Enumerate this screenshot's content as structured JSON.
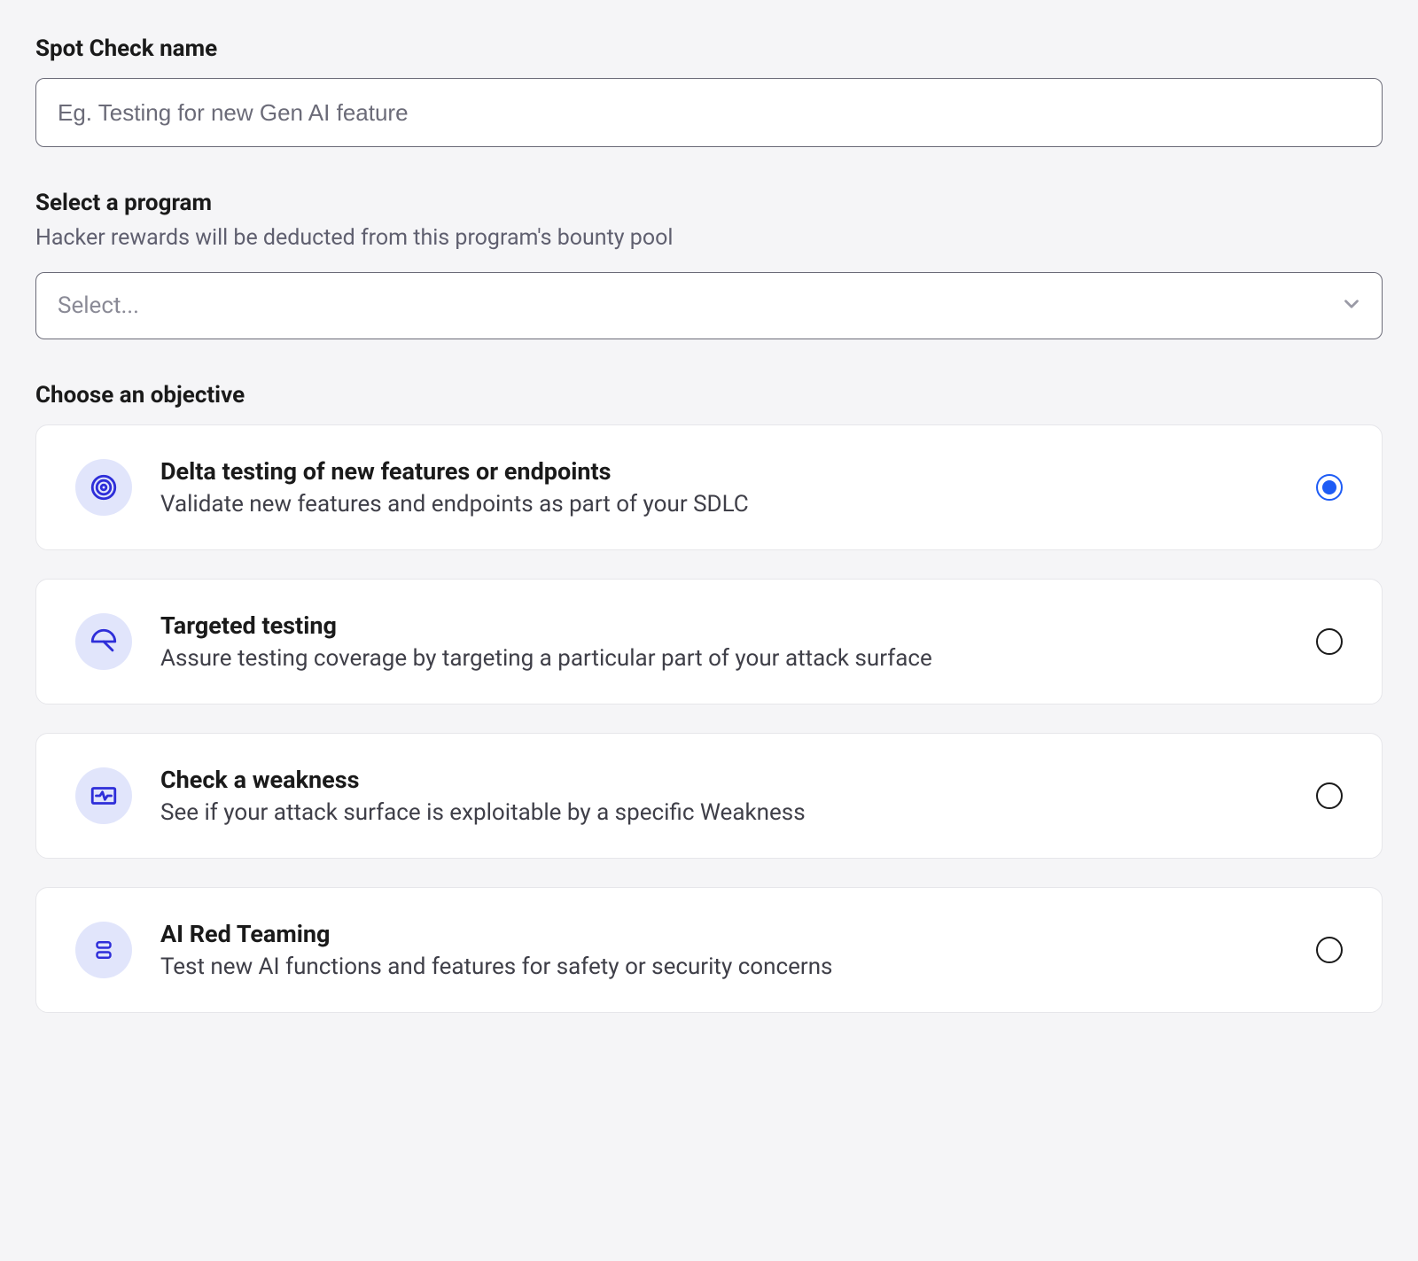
{
  "name_field": {
    "label": "Spot Check name",
    "placeholder": "Eg. Testing for new Gen AI feature",
    "value": ""
  },
  "program_field": {
    "label": "Select a program",
    "hint": "Hacker rewards will be deducted from this program's bounty pool",
    "placeholder": "Select..."
  },
  "objective_section": {
    "label": "Choose an objective"
  },
  "objectives": [
    {
      "id": "delta",
      "title": "Delta testing of new features or endpoints",
      "desc": "Validate new features and endpoints as part of your SDLC",
      "selected": true
    },
    {
      "id": "targeted",
      "title": "Targeted testing",
      "desc": "Assure testing coverage by targeting a particular part of your attack surface",
      "selected": false
    },
    {
      "id": "weakness",
      "title": "Check a weakness",
      "desc": "See if your attack surface is exploitable by a specific Weakness",
      "selected": false
    },
    {
      "id": "ai",
      "title": "AI Red Teaming",
      "desc": "Test new AI functions and features for safety or security concerns",
      "selected": false
    }
  ]
}
